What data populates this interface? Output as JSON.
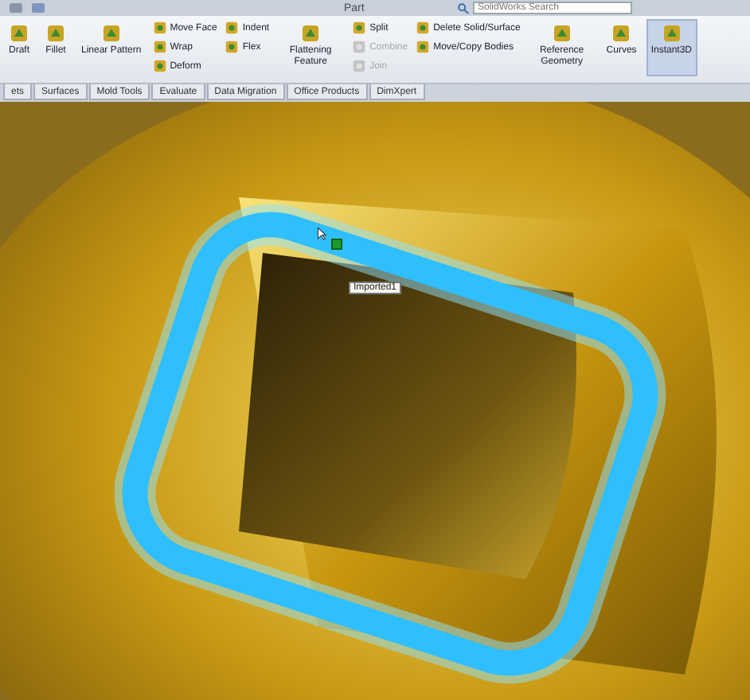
{
  "window": {
    "title": "Part"
  },
  "search": {
    "placeholder": "SolidWorks Search"
  },
  "ribbon": [
    {
      "kind": "large",
      "label": "Draft",
      "selected": false
    },
    {
      "kind": "large",
      "label": "Fillet",
      "selected": false
    },
    {
      "kind": "large",
      "label": "Linear Pattern",
      "selected": false
    },
    {
      "kind": "stack",
      "items": [
        {
          "label": "Move Face",
          "disabled": false
        },
        {
          "label": "Wrap",
          "disabled": false
        },
        {
          "label": "Deform",
          "disabled": false
        }
      ]
    },
    {
      "kind": "stack",
      "items": [
        {
          "label": "Indent",
          "disabled": false
        },
        {
          "label": "Flex",
          "disabled": false
        }
      ]
    },
    {
      "kind": "large",
      "label": "Flattening Feature",
      "selected": false
    },
    {
      "kind": "stack",
      "items": [
        {
          "label": "Split",
          "disabled": false
        },
        {
          "label": "Combine",
          "disabled": true
        },
        {
          "label": "Join",
          "disabled": true
        }
      ]
    },
    {
      "kind": "stack",
      "items": [
        {
          "label": "Delete Solid/Surface",
          "disabled": false
        },
        {
          "label": "Move/Copy Bodies",
          "disabled": false
        }
      ]
    },
    {
      "kind": "large",
      "label": "Reference Geometry",
      "selected": false
    },
    {
      "kind": "large",
      "label": "Curves",
      "selected": false
    },
    {
      "kind": "large",
      "label": "Instant3D",
      "selected": true
    }
  ],
  "tabs": [
    {
      "label": "ets",
      "selected": false
    },
    {
      "label": "Surfaces",
      "selected": false
    },
    {
      "label": "Mold Tools",
      "selected": false
    },
    {
      "label": "Evaluate",
      "selected": false
    },
    {
      "label": "Data Migration",
      "selected": false
    },
    {
      "label": "Office Products",
      "selected": false
    },
    {
      "label": "DimXpert",
      "selected": false
    }
  ],
  "viewport": {
    "tooltip": "Imported1"
  }
}
